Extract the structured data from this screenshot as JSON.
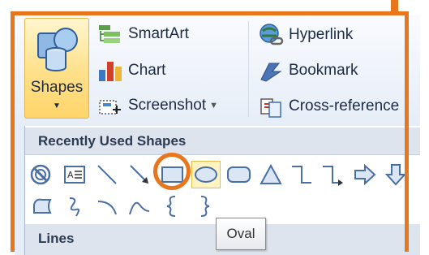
{
  "ribbon": {
    "shapes_label": "Shapes",
    "smartart_label": "SmartArt",
    "chart_label": "Chart",
    "screenshot_label": "Screenshot",
    "hyperlink_label": "Hyperlink",
    "bookmark_label": "Bookmark",
    "crossref_label": "Cross-reference"
  },
  "gallery": {
    "recent_header": "Recently Used Shapes",
    "lines_header": "Lines",
    "hovered_shape": "Oval"
  },
  "tooltip": {
    "text": "Oval"
  },
  "colors": {
    "highlight": "#e8761c",
    "hover": "#fff3c2",
    "icon": "#4a6fa5"
  }
}
